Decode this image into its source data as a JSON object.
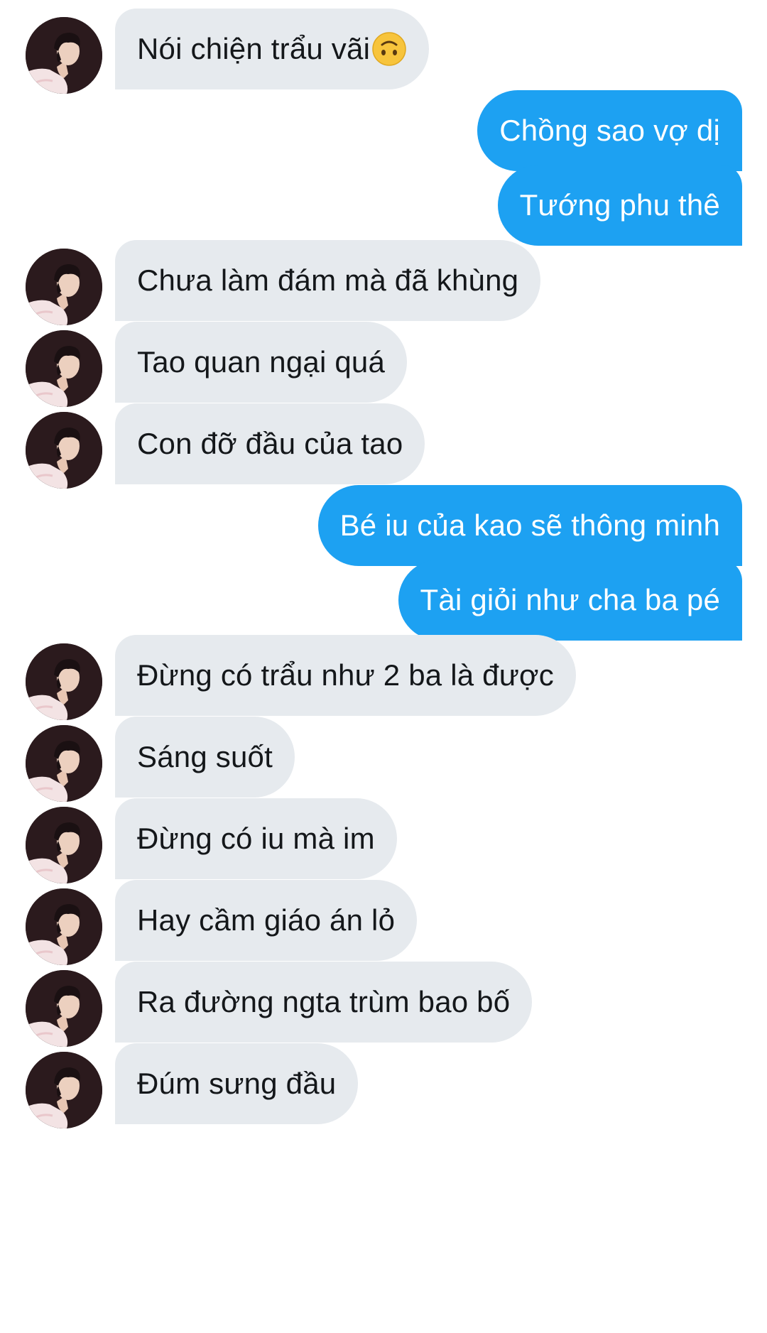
{
  "conversation": {
    "messages": [
      {
        "sender": "other",
        "text": "Nói chiện trẩu vãi",
        "emoji": "upside-down-face-icon"
      },
      {
        "sender": "me",
        "text": "Chồng sao vợ dị"
      },
      {
        "sender": "me",
        "text": "Tướng phu thê"
      },
      {
        "sender": "other",
        "text": "Chưa làm đám mà đã khùng"
      },
      {
        "sender": "other",
        "text": "Tao quan ngại quá"
      },
      {
        "sender": "other",
        "text": "Con đỡ đầu của tao"
      },
      {
        "sender": "me",
        "text": "Bé iu của kao sẽ thông minh"
      },
      {
        "sender": "me",
        "text": "Tài giỏi như cha ba pé"
      },
      {
        "sender": "other",
        "text": "Đừng có trẩu như 2 ba là được"
      },
      {
        "sender": "other",
        "text": "Sáng suốt"
      },
      {
        "sender": "other",
        "text": "Đừng có iu mà im"
      },
      {
        "sender": "other",
        "text": "Hay cầm giáo án lỏ"
      },
      {
        "sender": "other",
        "text": "Ra đường ngta trùm bao bố"
      },
      {
        "sender": "other",
        "text": "Đúm sưng đầu"
      }
    ]
  },
  "colors": {
    "incoming_bubble": "#e6eaee",
    "outgoing_bubble": "#1da1f2",
    "incoming_text": "#14171a",
    "outgoing_text": "#ffffff"
  }
}
